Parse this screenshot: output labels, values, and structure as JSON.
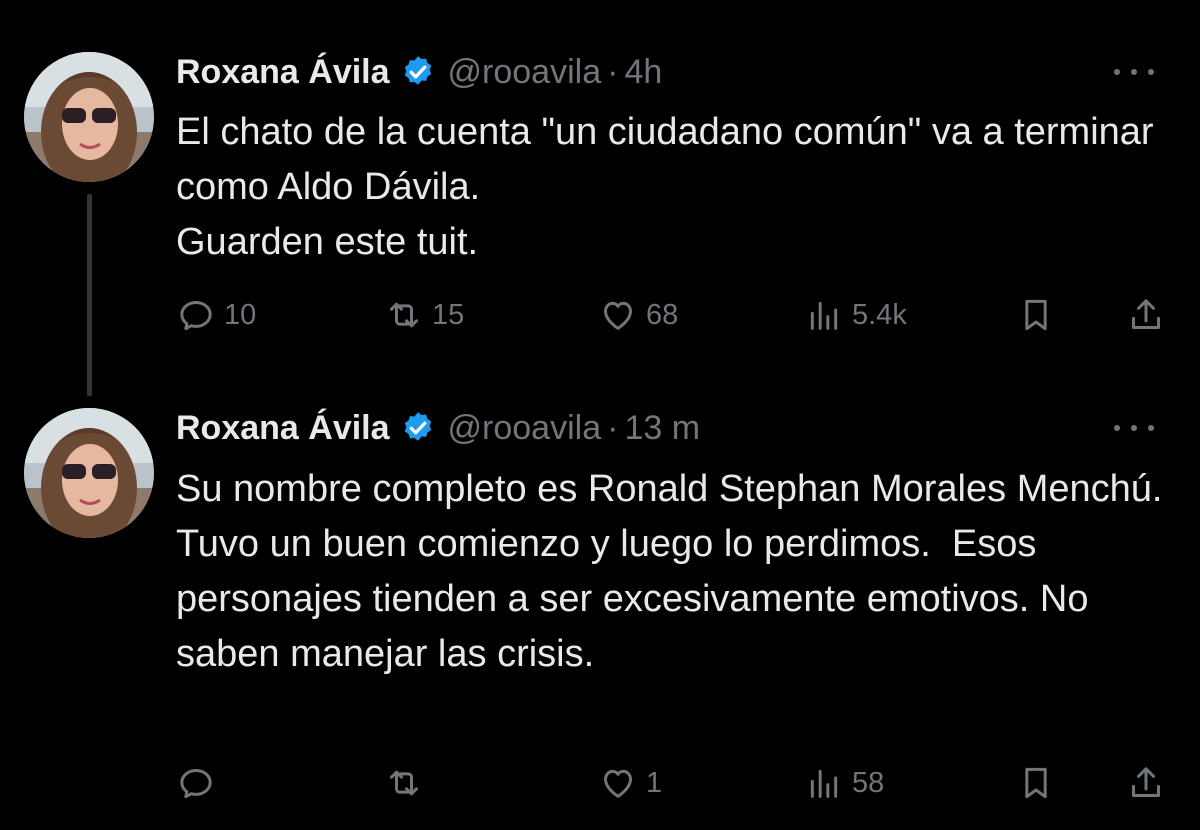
{
  "colors": {
    "background": "#000000",
    "text": "#e7e9ea",
    "muted": "#71767b",
    "verified": "#1d9bf0",
    "thread_line": "#333639"
  },
  "tweets": [
    {
      "author": {
        "name": "Roxana Ávila",
        "handle": "@rooavila",
        "verified": true,
        "avatar_icon": "profile-photo"
      },
      "separator": "·",
      "time": "4h",
      "lines": [
        "El chato de la cuenta \"un ciudadano común\" va a terminar como Aldo Dávila.",
        "Guarden este tuit."
      ],
      "actions": {
        "replies": "10",
        "retweets": "15",
        "likes": "68",
        "views": "5.4k"
      }
    },
    {
      "author": {
        "name": "Roxana Ávila",
        "handle": "@rooavila",
        "verified": true,
        "avatar_icon": "profile-photo"
      },
      "separator": "·",
      "time": "13 m",
      "lines": [
        "Su nombre completo es Ronald Stephan Morales Menchú.",
        "Tuvo un buen comienzo y luego lo perdimos.  Esos personajes tienden a ser excesivamente emotivos. No saben manejar las crisis."
      ],
      "actions": {
        "replies": "",
        "retweets": "",
        "likes": "1",
        "views": "58"
      }
    }
  ]
}
